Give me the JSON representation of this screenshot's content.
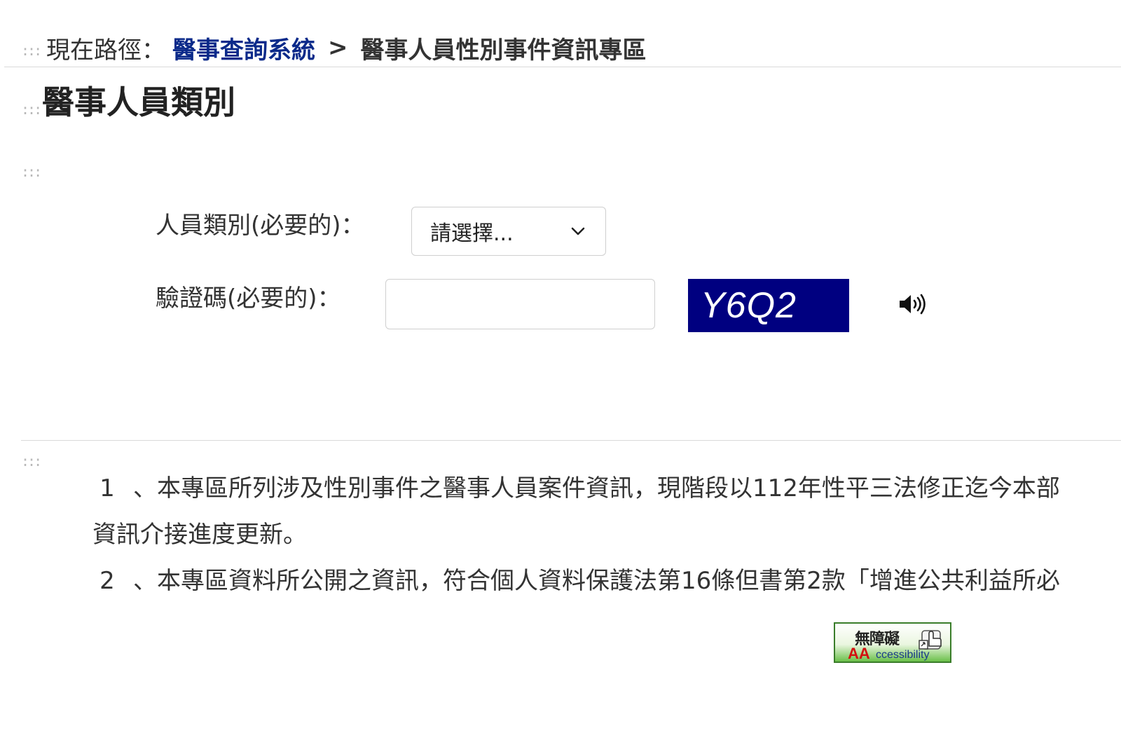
{
  "accesskey_marker": ":::",
  "breadcrumb": {
    "label": "現在路徑：",
    "link": "醫事查詢系統",
    "separator": ">",
    "current": "醫事人員性別事件資訊專區"
  },
  "page_title": "醫事人員類別",
  "form": {
    "category_label": "人員類別(必要的)：",
    "category_select_value": "請選擇...",
    "captcha_label": "驗證碼(必要的)：",
    "captcha_input_value": "",
    "captcha_code": "Y6Q2"
  },
  "icons": {
    "select": "chevron-down-icon",
    "audio": "speaker-icon",
    "accessibility": "accessibility-badge"
  },
  "notes": [
    {
      "number": "1",
      "line1": "、本專區所列涉及性別事件之醫事人員案件資訊，現階段以112年性平三法修正迄今本部",
      "line2": "資訊介接進度更新。"
    },
    {
      "number": "2",
      "line1": "、本專區資料所公開之資訊，符合個人資料保護法第16條但書第2款「增進公共利益所必"
    }
  ],
  "accessibility_badge": {
    "top_text": "無障礙",
    "aa_text": "AA",
    "word_text": "ccessibility"
  },
  "colors": {
    "link": "#0b2a8a",
    "captcha_bg": "#000080",
    "captcha_text": "#ffffff",
    "badge_border": "#3a7d2a"
  }
}
